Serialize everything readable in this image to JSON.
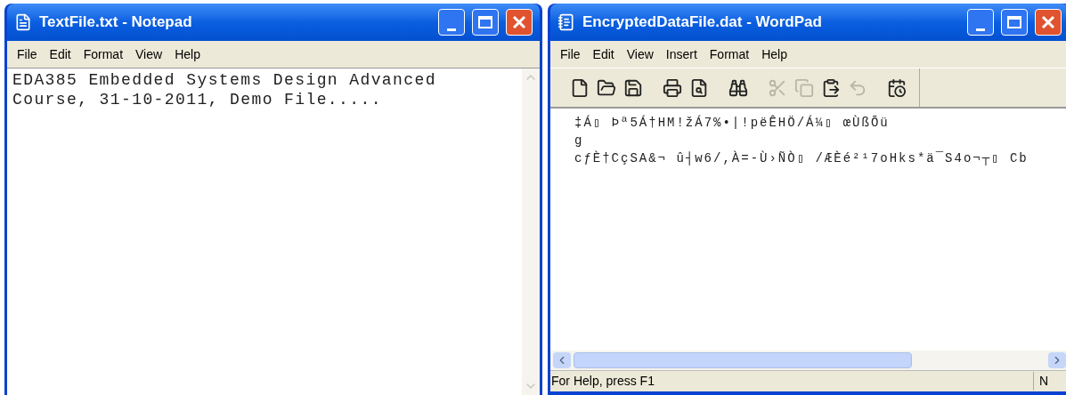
{
  "windows": [
    {
      "kind": "notepad",
      "title": "TextFile.txt - Notepad",
      "menu": [
        "File",
        "Edit",
        "Format",
        "View",
        "Help"
      ],
      "lines": [
        "EDA385 Embedded Systems Design Advanced",
        "Course, 31-10-2011, Demo File....."
      ]
    },
    {
      "kind": "wordpad",
      "title": "EncryptedDataFile.dat - WordPad",
      "menu": [
        "File",
        "Edit",
        "View",
        "Insert",
        "Format",
        "Help"
      ],
      "toolbar": [
        {
          "kind": "new",
          "disabled": false
        },
        {
          "kind": "open",
          "disabled": false
        },
        {
          "kind": "save",
          "disabled": false
        },
        {
          "kind": "print",
          "disabled": false
        },
        {
          "kind": "preview",
          "disabled": false
        },
        {
          "kind": "find",
          "disabled": false
        },
        {
          "kind": "cut",
          "disabled": true
        },
        {
          "kind": "copy",
          "disabled": true
        },
        {
          "kind": "paste",
          "disabled": false
        },
        {
          "kind": "undo",
          "disabled": true
        },
        {
          "kind": "datetime",
          "disabled": false
        }
      ],
      "lines": [
        "‡Á▯ Þª5Á†HM!žÁ7%•|!pëÊHÖ/Á¼▯ œÙßÕü",
        "g",
        "cƒÈ†CçSA&¬ û┤w6/,À=-Ù›ÑÒ▯ /ÆÈé²¹7oHks*ä¯S4o¬┬▯ Cb"
      ],
      "status": [
        "For Help, press F1",
        "N"
      ]
    }
  ]
}
